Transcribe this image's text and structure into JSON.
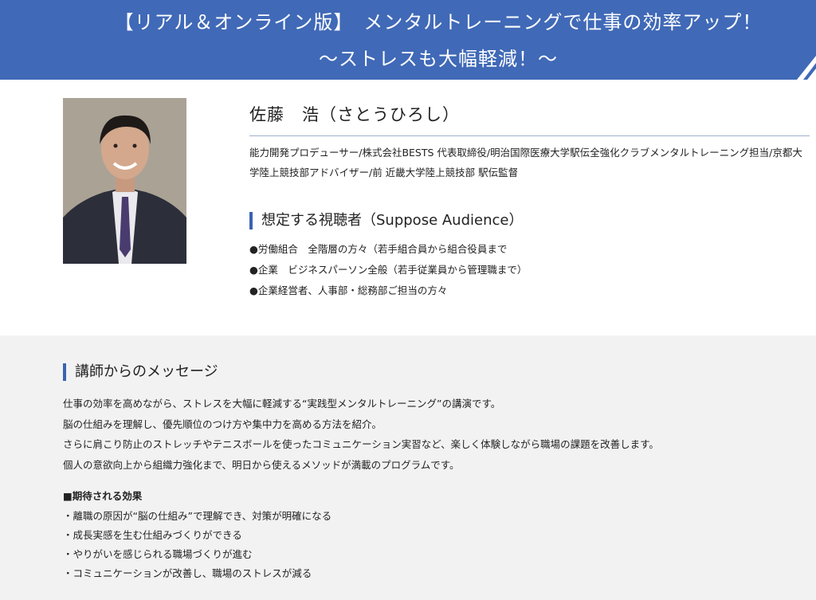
{
  "banner": {
    "line1": "【リアル＆オンライン版】　メンタルトレーニングで仕事の効率アップ！",
    "line2": "〜ストレスも大幅軽減！〜"
  },
  "speaker": {
    "name": "佐藤　浩（さとうひろし）",
    "bio": "能力開発プロデューサー/株式会社BESTS 代表取締役/明治国際医療大学駅伝全強化クラブメンタルトレーニング担当/京都大学陸上競技部アドバイザー/前 近畿大学陸上競技部 駅伝監督"
  },
  "audience": {
    "heading": "想定する視聴者（Suppose Audience）",
    "items": [
      "●労働組合　全階層の方々（若手組合員から組合役員まで",
      "●企業　ビジネスパーソン全般（若手従業員から管理職まで）",
      "●企業経営者、人事部・総務部ご担当の方々"
    ]
  },
  "message": {
    "heading": "講師からのメッセージ",
    "paragraphs": [
      "仕事の効率を高めながら、ストレスを大幅に軽減する“実践型メンタルトレーニング”の講演です。",
      "脳の仕組みを理解し、優先順位のつけ方や集中力を高める方法を紹介。",
      "さらに肩こり防止のストレッチやテニスボールを使ったコミュニケーション実習など、楽しく体験しながら職場の課題を改善します。",
      "個人の意欲向上から組織力強化まで、明日から使えるメソッドが満載のプログラムです。"
    ],
    "effects_title": "■期待される効果",
    "effects": [
      "・離職の原因が“脳の仕組み”で理解でき、対策が明確になる",
      "・成長実感を生む仕組みづくりができる",
      "・やりがいを感じられる職場づくりが進む",
      "・コミュニケーションが改善し、職場のストレスが減る"
    ]
  },
  "colors": {
    "banner": "#4069b7",
    "accent": "#3a63b0",
    "lower_background": "#f2f2f2"
  }
}
